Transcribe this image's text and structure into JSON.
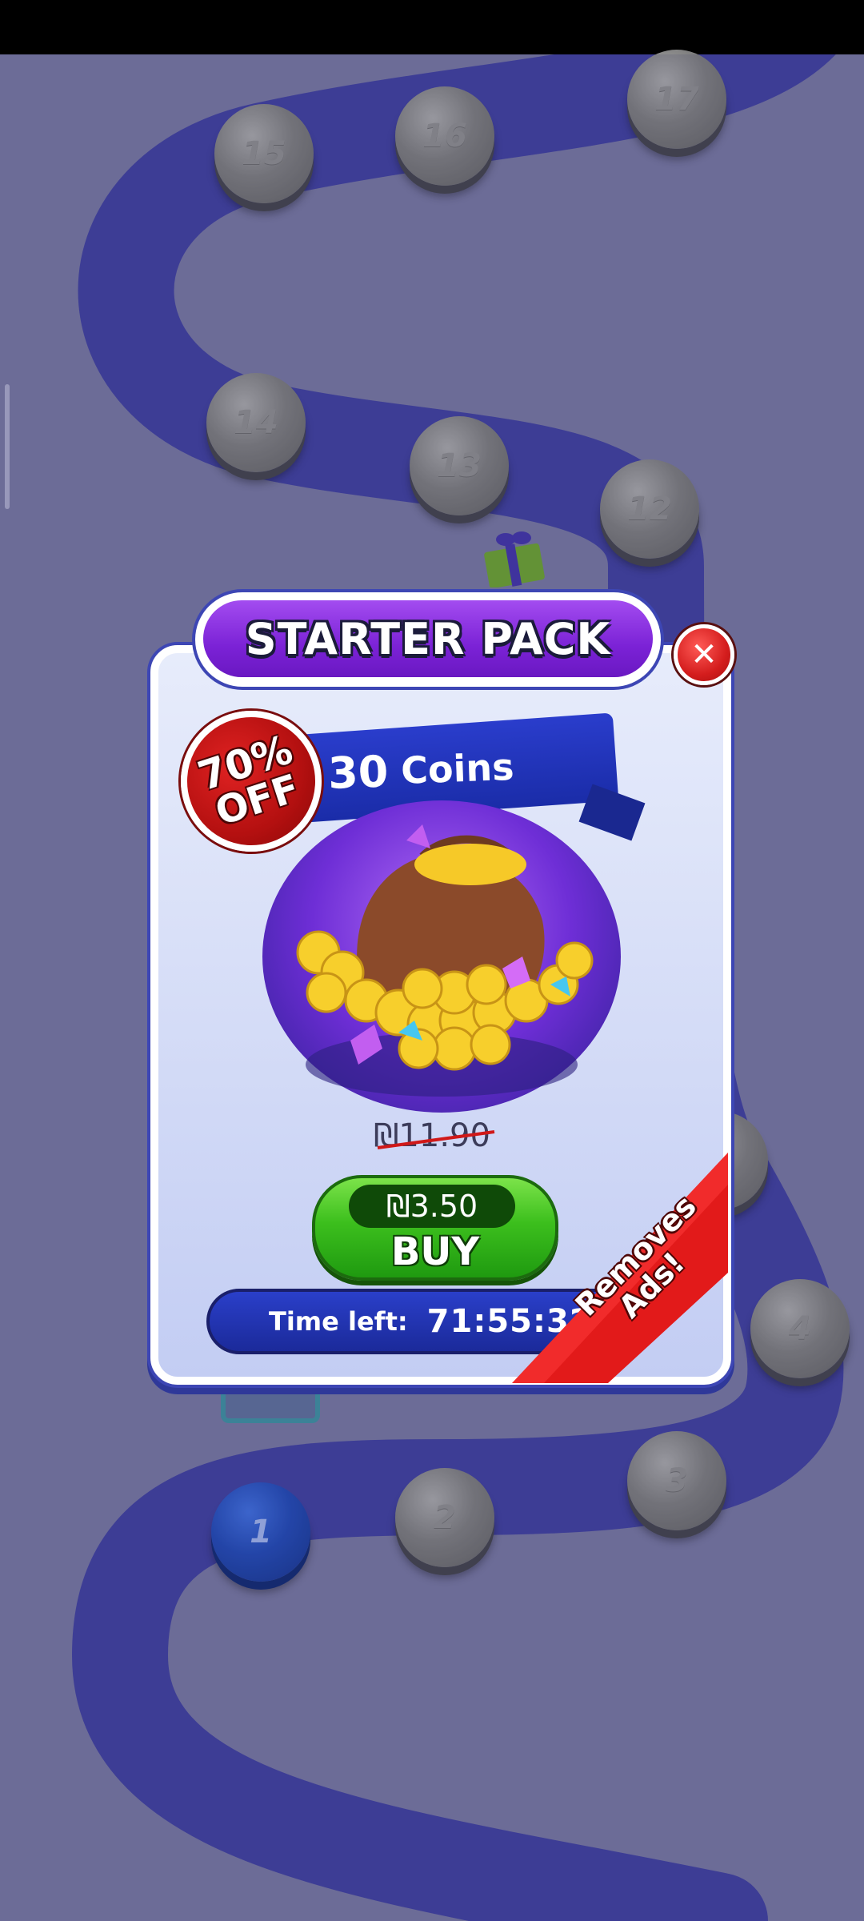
{
  "map": {
    "levels": [
      {
        "label": "15",
        "state": "locked"
      },
      {
        "label": "16",
        "state": "locked"
      },
      {
        "label": "17",
        "state": "locked"
      },
      {
        "label": "14",
        "state": "locked"
      },
      {
        "label": "13",
        "state": "locked"
      },
      {
        "label": "12",
        "state": "locked"
      },
      {
        "label": "4",
        "state": "locked"
      },
      {
        "label": "3",
        "state": "locked"
      },
      {
        "label": "2",
        "state": "locked"
      },
      {
        "label": "1",
        "state": "current"
      }
    ],
    "path_color": "#3b3b9e",
    "background_color": "#7474a0"
  },
  "popup": {
    "title": "STARTER PACK",
    "discount": {
      "percent": "70%",
      "label": "OFF"
    },
    "bundle": {
      "amount": "30",
      "unit": "Coins"
    },
    "old_price": "₪11.90",
    "new_price": "₪3.50",
    "buy_label": "BUY",
    "timer": {
      "label": "Time left:",
      "value": "71:55:32"
    },
    "removes_ads": {
      "line1": "Removes",
      "line2": "Ads!"
    },
    "colors": {
      "title": "#7b22d6",
      "buy": "#3cbf1d",
      "badge": "#c41515",
      "ribbon": "#1f30b0"
    }
  }
}
